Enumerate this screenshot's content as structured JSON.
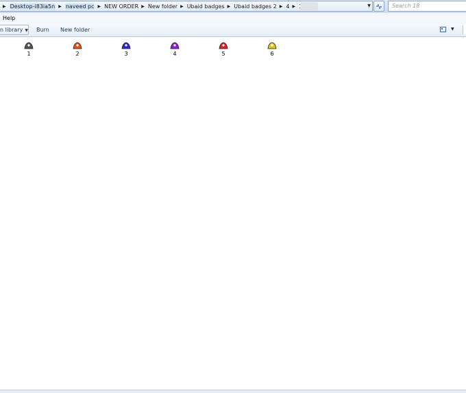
{
  "address_bar": {
    "crumbs": [
      "Desktop-i83ia5n",
      "naveed pc",
      "NEW ORDER",
      "New folder",
      "Ubaid badges",
      "Ubaid badges 2",
      "4",
      "18"
    ]
  },
  "search": {
    "placeholder": "Search 18"
  },
  "menu": {
    "items": [
      "Help"
    ]
  },
  "toolbar": {
    "library_label": "n library",
    "burn_label": "Burn",
    "new_folder_label": "New folder"
  },
  "files": [
    {
      "name": "1",
      "color": "#555555"
    },
    {
      "name": "2",
      "color": "#e0521a"
    },
    {
      "name": "3",
      "color": "#2a2ad0"
    },
    {
      "name": "4",
      "color": "#8e1fd0"
    },
    {
      "name": "5",
      "color": "#d8232a"
    },
    {
      "name": "6",
      "color": "#e0c21a"
    }
  ]
}
